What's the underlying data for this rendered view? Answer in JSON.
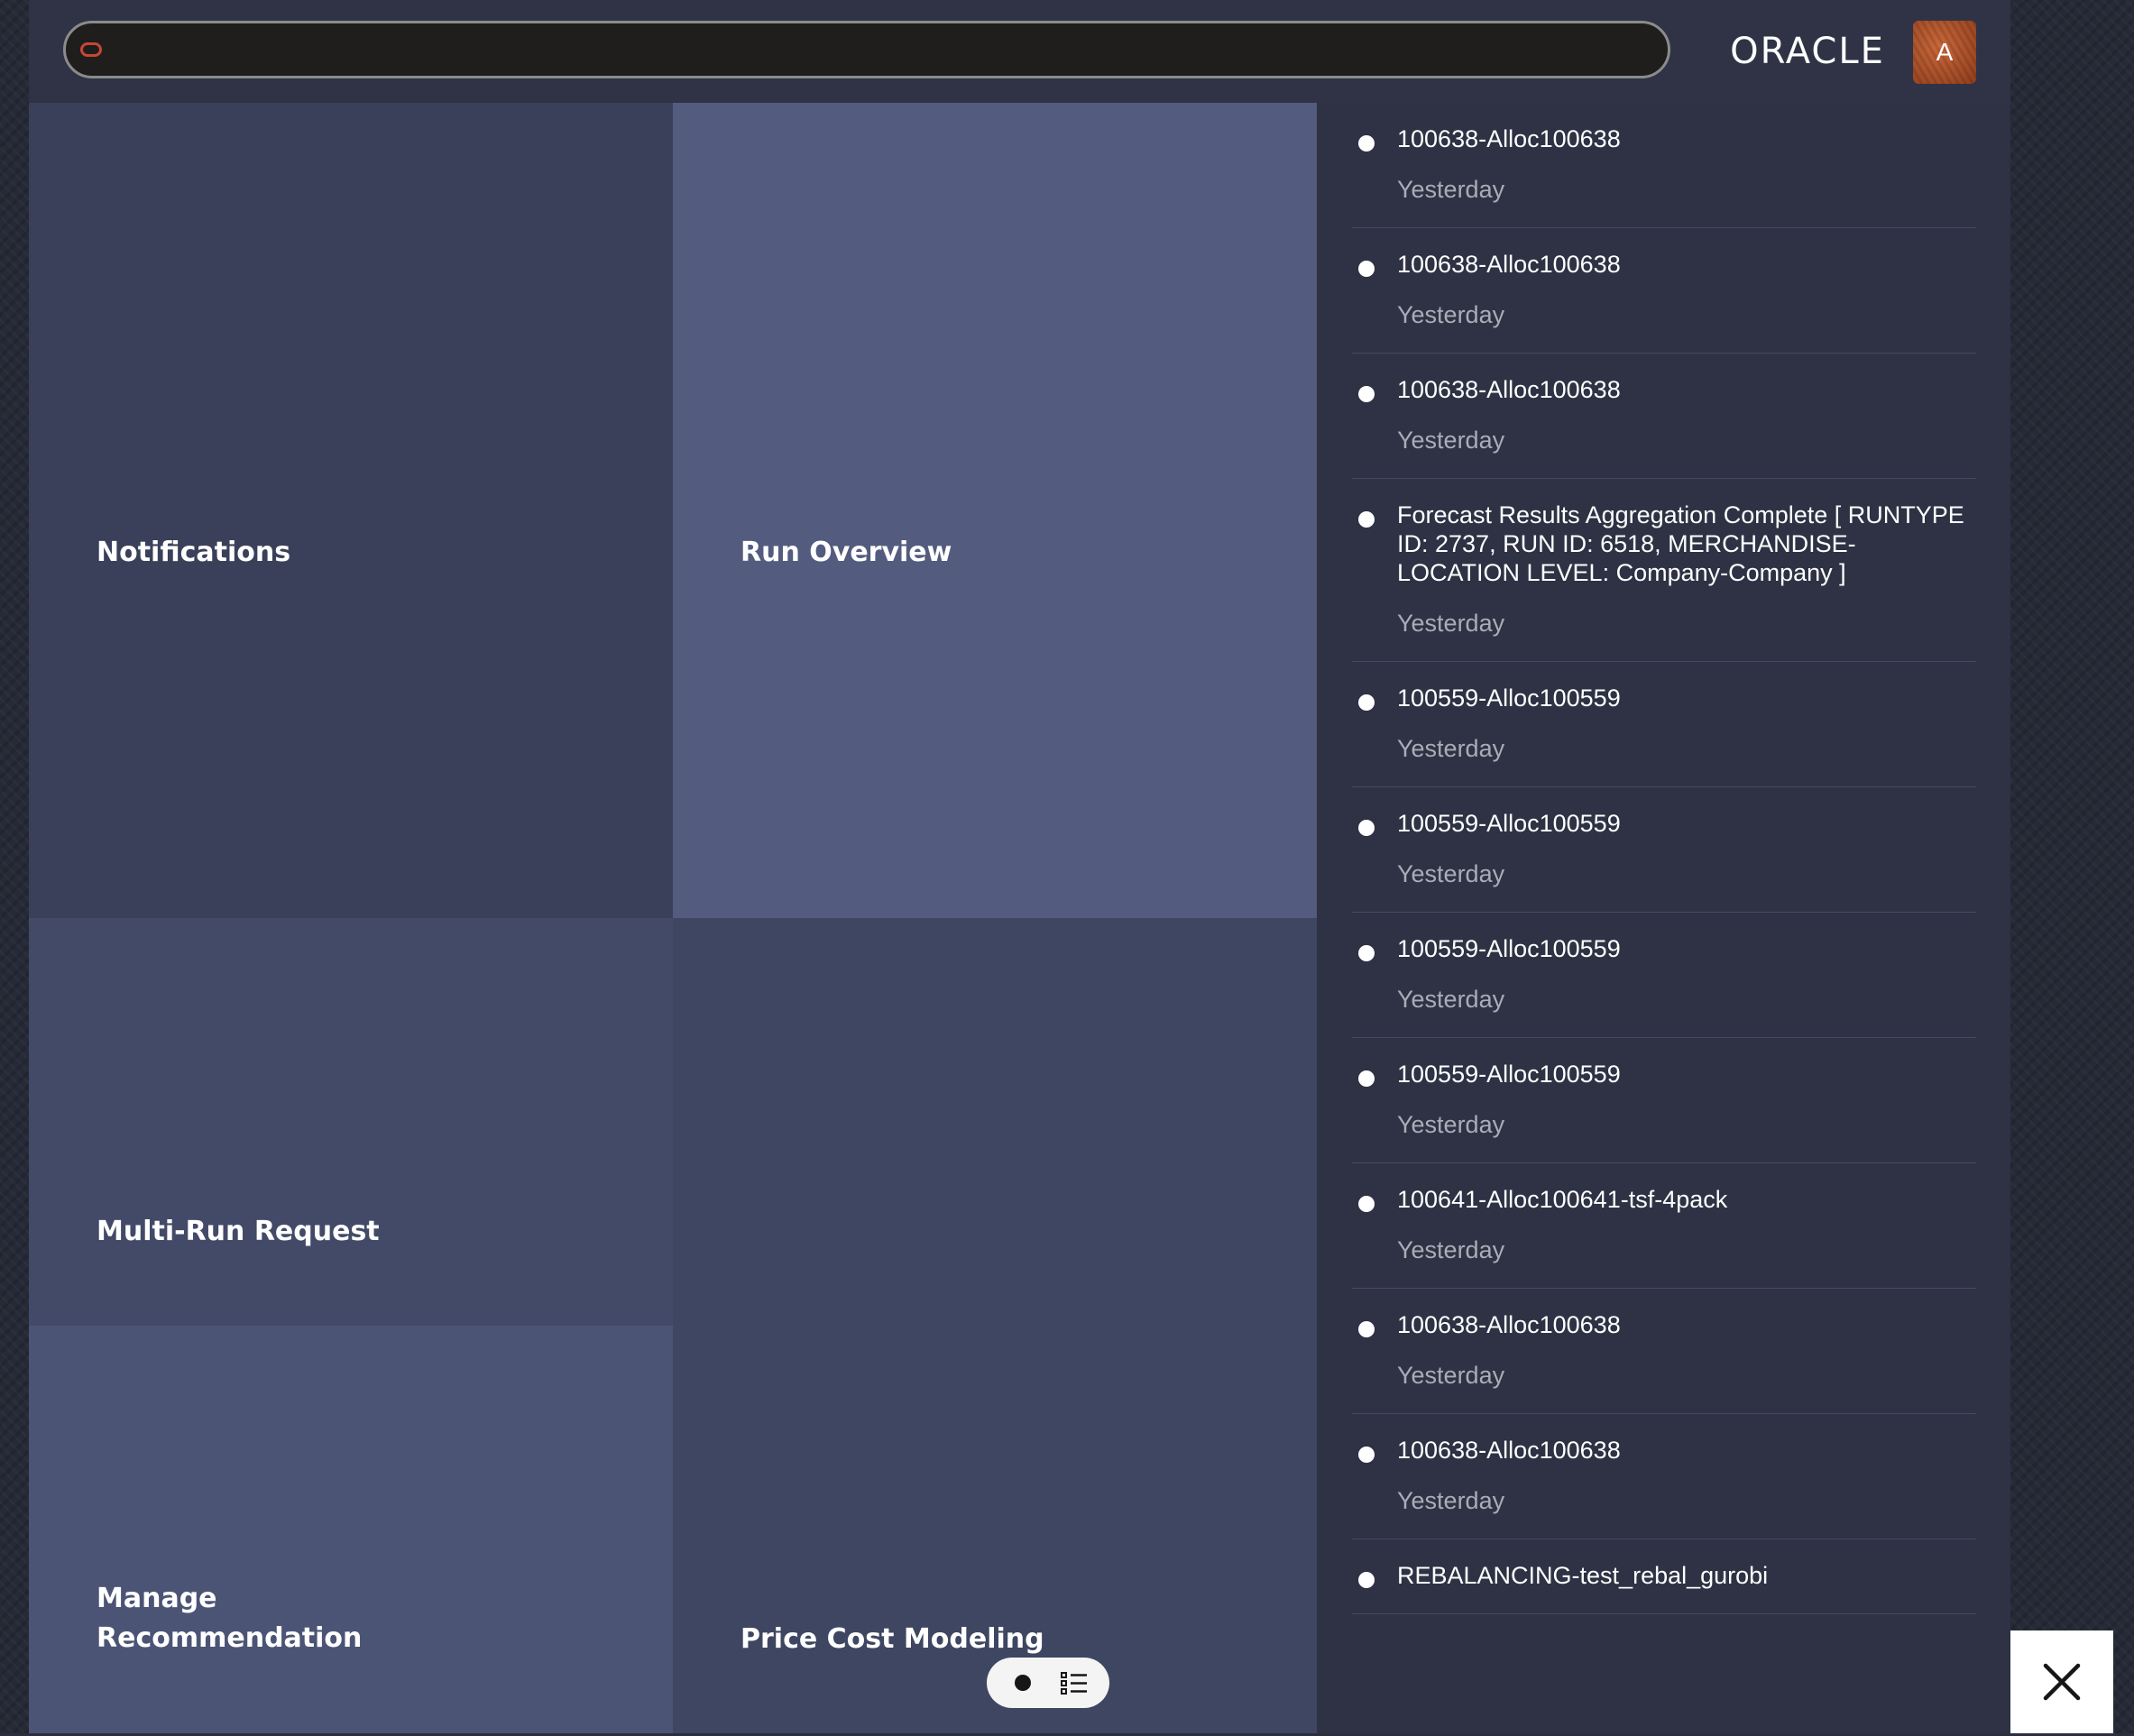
{
  "header": {
    "search": {
      "value": "",
      "placeholder": ""
    },
    "logo_text": "ORACLE",
    "avatar_initial": "A"
  },
  "tiles": {
    "notifications": "Notifications",
    "run_overview": "Run Overview",
    "multi_run_request": "Multi-Run Request",
    "manage_recommendation": "Manage\nRecommendation",
    "price_cost_modeling": "Price Cost Modeling"
  },
  "notifications": [
    {
      "title": "100638-Alloc100638",
      "time": "Yesterday"
    },
    {
      "title": "100638-Alloc100638",
      "time": "Yesterday"
    },
    {
      "title": "100638-Alloc100638",
      "time": "Yesterday"
    },
    {
      "title": "Forecast Results Aggregation Complete [ RUNTYPE ID: 2737, RUN ID: 6518, MERCHANDISE-LOCATION LEVEL: Company-Company ]",
      "time": "Yesterday"
    },
    {
      "title": "100559-Alloc100559",
      "time": "Yesterday"
    },
    {
      "title": "100559-Alloc100559",
      "time": "Yesterday"
    },
    {
      "title": "100559-Alloc100559",
      "time": "Yesterday"
    },
    {
      "title": "100559-Alloc100559",
      "time": "Yesterday"
    },
    {
      "title": "100641-Alloc100641-tsf-4pack",
      "time": "Yesterday"
    },
    {
      "title": "100638-Alloc100638",
      "time": "Yesterday"
    },
    {
      "title": "100638-Alloc100638",
      "time": "Yesterday"
    },
    {
      "title": "REBALANCING-test_rebal_gurobi",
      "time": ""
    }
  ],
  "colors": {
    "brand_red": "#c74634",
    "app_background": "#2e3244",
    "tile_notifications": "#3a405a",
    "tile_run_overview": "#535c7e"
  },
  "icons": {
    "search_bar_icon": "oracle-o-icon",
    "toolbar_record": "record-icon",
    "toolbar_list": "list-icon",
    "close": "close-icon"
  }
}
